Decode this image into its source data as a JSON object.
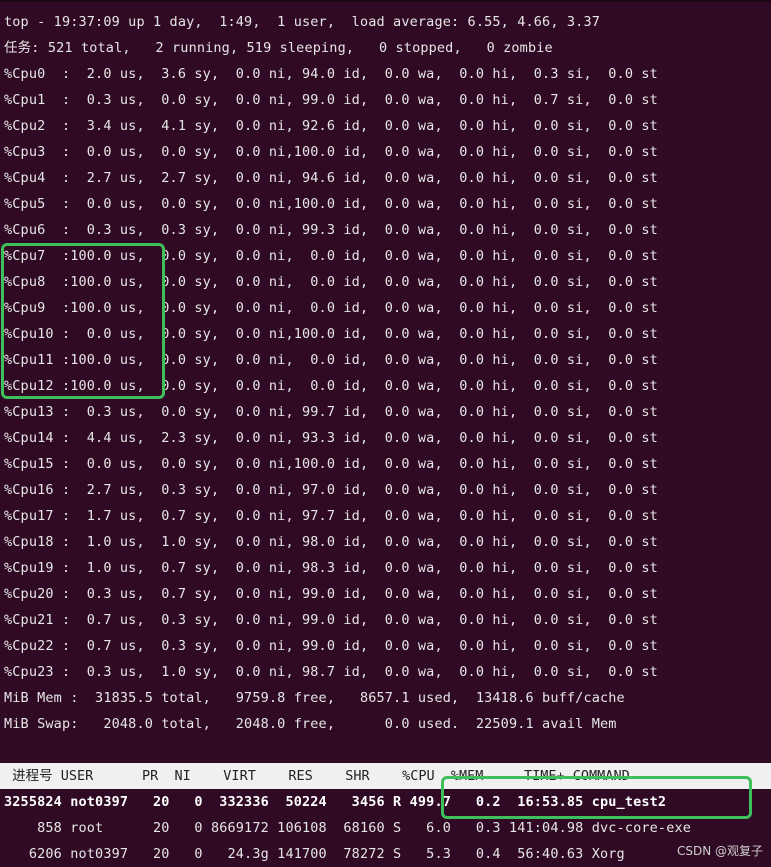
{
  "summary": [
    "top - 19:37:09 up 1 day,  1:49,  1 user,  load average: 6.55, 4.66, 3.37",
    "任务: 521 total,   2 running, 519 sleeping,   0 stopped,   0 zombie"
  ],
  "cpu_lines": [
    "%Cpu0  :  2.0 us,  3.6 sy,  0.0 ni, 94.0 id,  0.0 wa,  0.0 hi,  0.3 si,  0.0 st",
    "%Cpu1  :  0.3 us,  0.0 sy,  0.0 ni, 99.0 id,  0.0 wa,  0.0 hi,  0.7 si,  0.0 st",
    "%Cpu2  :  3.4 us,  4.1 sy,  0.0 ni, 92.6 id,  0.0 wa,  0.0 hi,  0.0 si,  0.0 st",
    "%Cpu3  :  0.0 us,  0.0 sy,  0.0 ni,100.0 id,  0.0 wa,  0.0 hi,  0.0 si,  0.0 st",
    "%Cpu4  :  2.7 us,  2.7 sy,  0.0 ni, 94.6 id,  0.0 wa,  0.0 hi,  0.0 si,  0.0 st",
    "%Cpu5  :  0.0 us,  0.0 sy,  0.0 ni,100.0 id,  0.0 wa,  0.0 hi,  0.0 si,  0.0 st",
    "%Cpu6  :  0.3 us,  0.3 sy,  0.0 ni, 99.3 id,  0.0 wa,  0.0 hi,  0.0 si,  0.0 st",
    "%Cpu7  :100.0 us,  0.0 sy,  0.0 ni,  0.0 id,  0.0 wa,  0.0 hi,  0.0 si,  0.0 st",
    "%Cpu8  :100.0 us,  0.0 sy,  0.0 ni,  0.0 id,  0.0 wa,  0.0 hi,  0.0 si,  0.0 st",
    "%Cpu9  :100.0 us,  0.0 sy,  0.0 ni,  0.0 id,  0.0 wa,  0.0 hi,  0.0 si,  0.0 st",
    "%Cpu10 :  0.0 us,  0.0 sy,  0.0 ni,100.0 id,  0.0 wa,  0.0 hi,  0.0 si,  0.0 st",
    "%Cpu11 :100.0 us,  0.0 sy,  0.0 ni,  0.0 id,  0.0 wa,  0.0 hi,  0.0 si,  0.0 st",
    "%Cpu12 :100.0 us,  0.0 sy,  0.0 ni,  0.0 id,  0.0 wa,  0.0 hi,  0.0 si,  0.0 st",
    "%Cpu13 :  0.3 us,  0.0 sy,  0.0 ni, 99.7 id,  0.0 wa,  0.0 hi,  0.0 si,  0.0 st",
    "%Cpu14 :  4.4 us,  2.3 sy,  0.0 ni, 93.3 id,  0.0 wa,  0.0 hi,  0.0 si,  0.0 st",
    "%Cpu15 :  0.0 us,  0.0 sy,  0.0 ni,100.0 id,  0.0 wa,  0.0 hi,  0.0 si,  0.0 st",
    "%Cpu16 :  2.7 us,  0.3 sy,  0.0 ni, 97.0 id,  0.0 wa,  0.0 hi,  0.0 si,  0.0 st",
    "%Cpu17 :  1.7 us,  0.7 sy,  0.0 ni, 97.7 id,  0.0 wa,  0.0 hi,  0.0 si,  0.0 st",
    "%Cpu18 :  1.0 us,  1.0 sy,  0.0 ni, 98.0 id,  0.0 wa,  0.0 hi,  0.0 si,  0.0 st",
    "%Cpu19 :  1.0 us,  0.7 sy,  0.0 ni, 98.3 id,  0.0 wa,  0.0 hi,  0.0 si,  0.0 st",
    "%Cpu20 :  0.3 us,  0.7 sy,  0.0 ni, 99.0 id,  0.0 wa,  0.0 hi,  0.0 si,  0.0 st",
    "%Cpu21 :  0.7 us,  0.3 sy,  0.0 ni, 99.0 id,  0.0 wa,  0.0 hi,  0.0 si,  0.0 st",
    "%Cpu22 :  0.7 us,  0.3 sy,  0.0 ni, 99.0 id,  0.0 wa,  0.0 hi,  0.0 si,  0.0 st",
    "%Cpu23 :  0.3 us,  1.0 sy,  0.0 ni, 98.7 id,  0.0 wa,  0.0 hi,  0.0 si,  0.0 st"
  ],
  "memory": [
    "MiB Mem :  31835.5 total,   9759.8 free,   8657.1 used,  13418.6 buff/cache",
    "MiB Swap:   2048.0 total,   2048.0 free,      0.0 used.  22509.1 avail Mem"
  ],
  "process_header": " 进程号 USER      PR  NI    VIRT    RES    SHR    %CPU  %MEM     TIME+ COMMAND",
  "processes": [
    "3255824 not0397   20   0  332336  50224   3456 R 499.7   0.2  16:53.85 cpu_test2",
    "    858 root      20   0 8669172 106108  68160 S   6.0   0.3 141:04.98 dvc-core-exe",
    "   6206 not0397   20   0   24.3g 141700  78272 S   5.3   0.4  56:40.63 Xorg"
  ],
  "watermark": "CSDN @观复子",
  "colors": {
    "background": "#300a24",
    "text": "#e6e6e6",
    "highlight_box": "#3fbf5a",
    "header_bg": "#f0f0f0"
  }
}
